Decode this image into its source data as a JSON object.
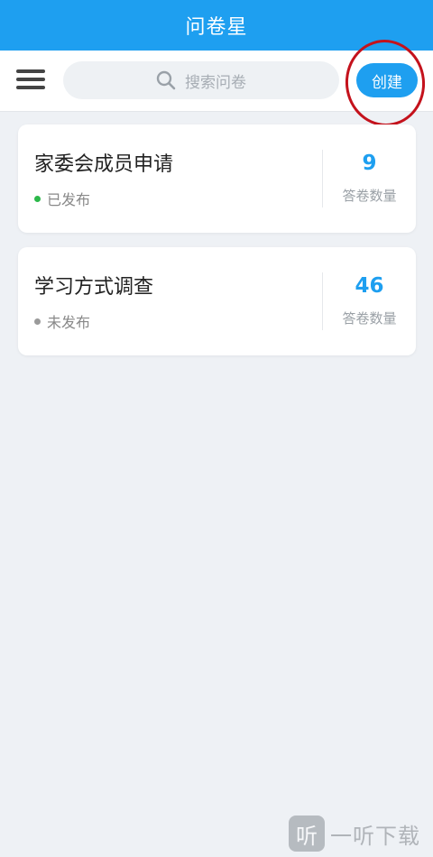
{
  "app": {
    "title": "问卷星"
  },
  "toolbar": {
    "menu_icon": "hamburger-menu-icon",
    "search_placeholder": "搜索问卷",
    "search_icon": "search-icon",
    "create_label": "创建"
  },
  "colors": {
    "brand": "#1e9ff0",
    "published": "#2cb84a",
    "unpublished": "#9a9a9a",
    "highlight": "#c4121c"
  },
  "surveys": [
    {
      "title": "家委会成员申请",
      "status": "已发布",
      "count": "9",
      "count_label": "答卷数量"
    },
    {
      "title": "学习方式调查",
      "status": "未发布",
      "count": "46",
      "count_label": "答卷数量"
    }
  ],
  "watermark": {
    "logo": "听",
    "text": "一听下载"
  }
}
